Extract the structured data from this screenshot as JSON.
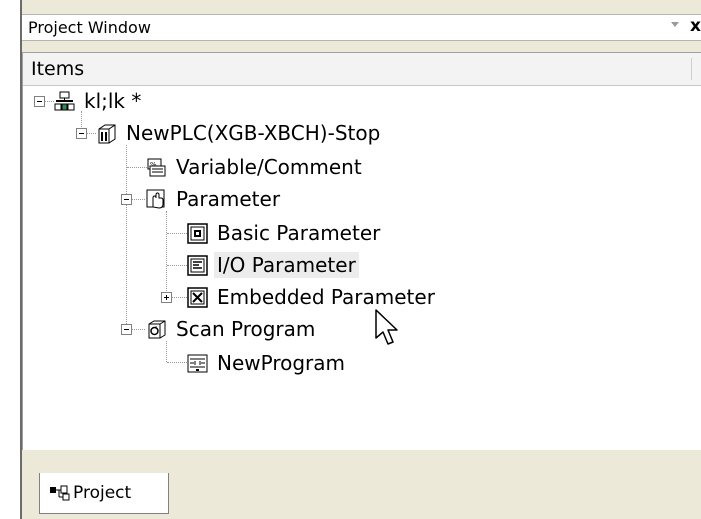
{
  "window": {
    "title": "Project Window",
    "close_glyph": "x"
  },
  "header": {
    "label": "Items"
  },
  "tree": [
    {
      "label": "kl;lk *",
      "icon": "network-project-icon",
      "expanded": true
    },
    {
      "label": "NewPLC(XGB-XBCH)-Stop",
      "icon": "plc-icon",
      "expanded": true
    },
    {
      "label": "Variable/Comment",
      "icon": "variable-comment-icon"
    },
    {
      "label": "Parameter",
      "icon": "parameter-icon",
      "expanded": true
    },
    {
      "label": "Basic Parameter",
      "icon": "basic-parameter-icon"
    },
    {
      "label": "I/O Parameter",
      "icon": "io-parameter-icon",
      "selected": true
    },
    {
      "label": "Embedded Parameter",
      "icon": "embedded-parameter-icon",
      "expanded": false
    },
    {
      "label": "Scan Program",
      "icon": "scan-program-icon",
      "expanded": true
    },
    {
      "label": "NewProgram",
      "icon": "program-icon"
    }
  ],
  "tabs": [
    {
      "label": "Project",
      "icon": "project-tab-icon",
      "active": true
    }
  ]
}
